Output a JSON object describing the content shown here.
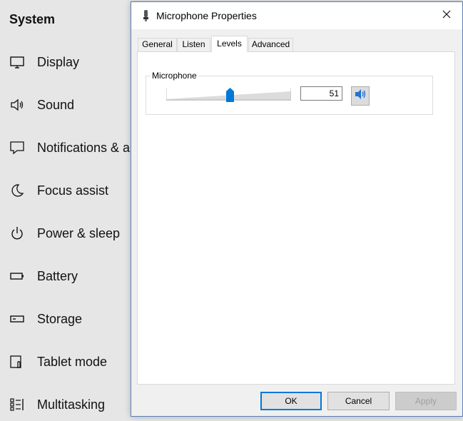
{
  "settings": {
    "title": "System",
    "nav": [
      {
        "label": "Display",
        "icon": "monitor-icon"
      },
      {
        "label": "Sound",
        "icon": "speaker-icon"
      },
      {
        "label": "Notifications & a",
        "icon": "notification-icon"
      },
      {
        "label": "Focus assist",
        "icon": "moon-icon"
      },
      {
        "label": "Power & sleep",
        "icon": "power-icon"
      },
      {
        "label": "Battery",
        "icon": "battery-icon"
      },
      {
        "label": "Storage",
        "icon": "storage-icon"
      },
      {
        "label": "Tablet mode",
        "icon": "tablet-mode-icon"
      },
      {
        "label": "Multitasking",
        "icon": "multitasking-icon"
      }
    ]
  },
  "dialog": {
    "title": "Microphone Properties",
    "title_icon": "microphone-icon",
    "tabs": [
      "General",
      "Listen",
      "Levels",
      "Advanced"
    ],
    "active_tab": "Levels",
    "levels": {
      "group_label": "Microphone",
      "level": 51,
      "level_text": "51",
      "mute_icon": "speaker-volume-icon"
    },
    "buttons": {
      "ok": "OK",
      "cancel": "Cancel",
      "apply": "Apply"
    }
  },
  "colors": {
    "accent": "#0078d7",
    "background": "#e6e6e6",
    "dialog_border": "#5a7fb5"
  }
}
